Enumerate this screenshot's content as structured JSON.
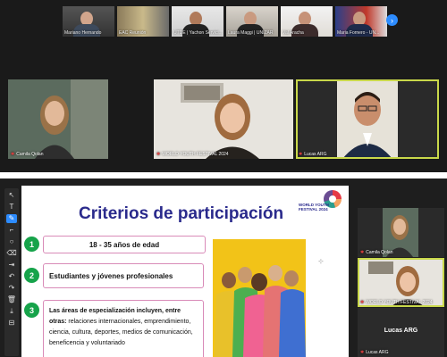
{
  "top": {
    "strip": [
      {
        "label": "Mariano Hernando"
      },
      {
        "label": "EAC Reunión"
      },
      {
        "label": "UTDE | Yachon Servici..."
      },
      {
        "label": "Laura Maggi | UNIZAR"
      },
      {
        "label": "Val Aracha"
      },
      {
        "label": "Maria Fornero - UN..."
      }
    ],
    "tiles": [
      {
        "label": "Camila Qolan"
      },
      {
        "label": "WORLD YOUTH FESTIVAL 2024"
      },
      {
        "label": "Lucas ARG"
      }
    ]
  },
  "bottom": {
    "toolbar": [
      "↖",
      "T",
      "✎",
      "⌐",
      "○",
      "⌫",
      "⇥",
      "↶",
      "↷",
      "🗑",
      "⤓",
      "⊟"
    ],
    "slide": {
      "title": "Criterios de participación",
      "logo_text": "WORLD YOUTH FESTIVAL 2024",
      "items": [
        {
          "num": "1",
          "text": "18 - 35 años de edad"
        },
        {
          "num": "2",
          "text": "Estudiantes y jóvenes profesionales"
        },
        {
          "num": "3",
          "heading": "Las áreas de especialización incluyen, entre otras:",
          "text": " relaciones internacionales, emprendimiento, ciencia, cultura, deportes, medios de comunicación, beneficencia y voluntariado"
        }
      ]
    },
    "right_panel": [
      {
        "label": "Camila Qolan"
      },
      {
        "label": "WORLD YOUTH FESTIVAL 2024"
      },
      {
        "label": "Lucas ARG",
        "name": "Lucas ARG"
      }
    ]
  },
  "colors": {
    "accent": "#2d8cff",
    "slide_title": "#2a2a8c",
    "bullet": "#16a34a",
    "box_border": "#d98bb8",
    "active_border": "#c9d84a"
  }
}
